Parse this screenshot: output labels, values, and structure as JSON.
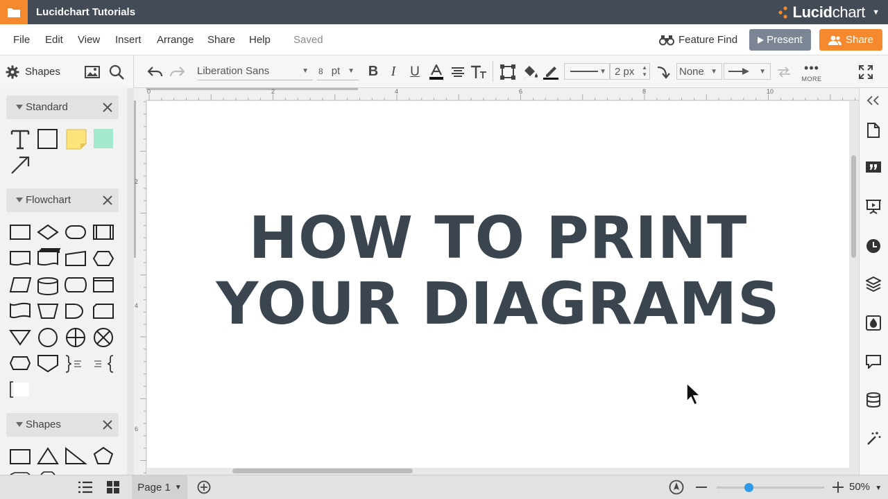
{
  "titlebar": {
    "title": "Lucidchart Tutorials",
    "brand_light": "Lucid",
    "brand_bold": "chart"
  },
  "menubar": {
    "items": [
      "File",
      "Edit",
      "View",
      "Insert",
      "Arrange",
      "Share",
      "Help"
    ],
    "status": "Saved",
    "feature_find": "Feature Find",
    "present": "Present",
    "share": "Share"
  },
  "toolbar": {
    "shapes_label": "Shapes",
    "font": "Liberation Sans",
    "font_size": "8",
    "font_unit": "pt",
    "line_width": "2 px",
    "arrow_start": "None",
    "more_label": "MORE"
  },
  "rulers": {
    "h_ticks": [
      "0",
      "2",
      "4",
      "6",
      "8",
      "10"
    ],
    "v_ticks": [
      "2",
      "4",
      "6"
    ]
  },
  "left_panel": {
    "libraries": [
      {
        "name": "Standard"
      },
      {
        "name": "Flowchart"
      },
      {
        "name": "Shapes"
      }
    ]
  },
  "canvas": {
    "headline_line1": "HOW TO PRINT",
    "headline_line2": "YOUR DIAGRAMS"
  },
  "bottombar": {
    "page_label": "Page 1",
    "zoom": "50%",
    "zoom_level": 0.3
  },
  "colors": {
    "titlebar": "#434b56",
    "accent_orange": "#f6892d",
    "present_button": "#7b8593",
    "headline_text": "#3a4550",
    "zoom_thumb": "#2d9be6",
    "sticky_note": "#fde37a",
    "mint_shape": "#a3e9cd"
  }
}
